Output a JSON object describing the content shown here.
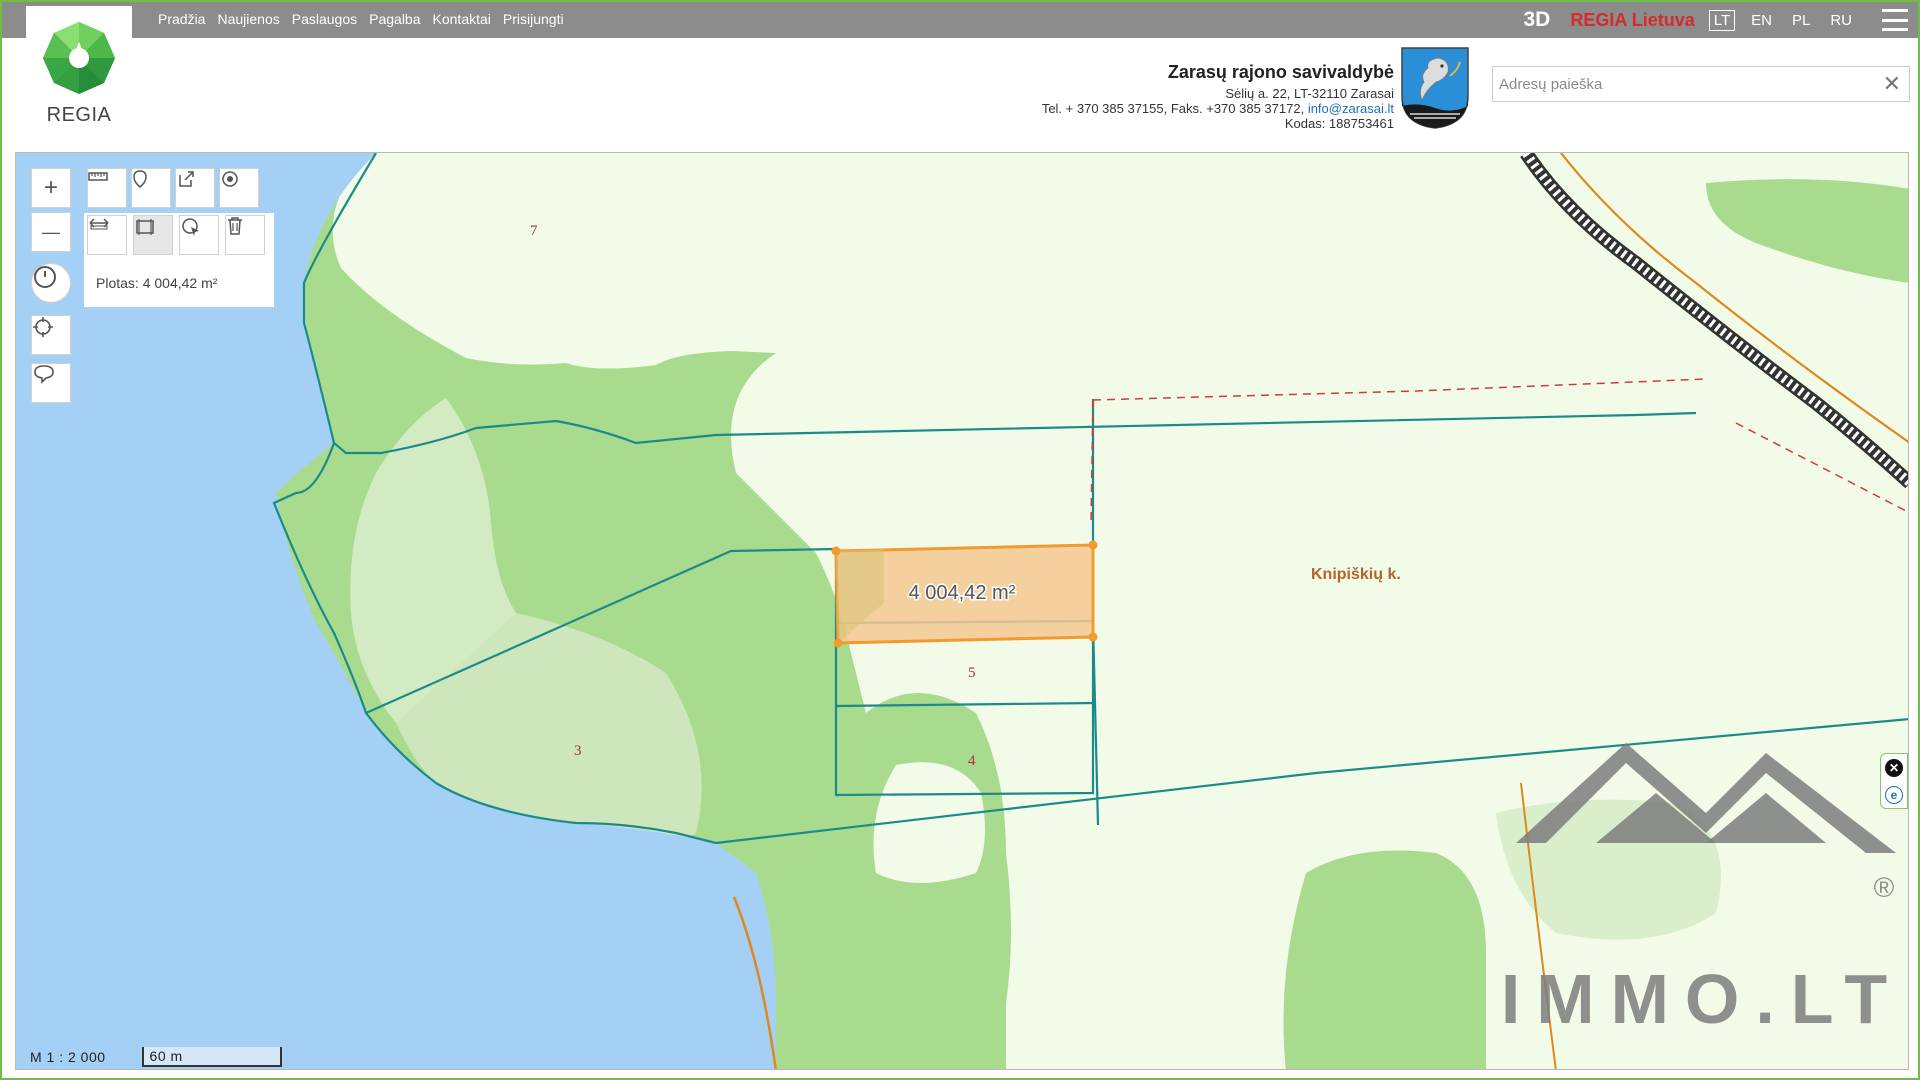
{
  "nav": {
    "items": [
      "Pradžia",
      "Naujienos",
      "Paslaugos",
      "Pagalba",
      "Kontaktai",
      "Prisijungti"
    ]
  },
  "logo": {
    "text": "REGIA"
  },
  "topright": {
    "mode_3d": "3D",
    "regia_lietuva": "REGIA Lietuva",
    "languages": [
      "LT",
      "EN",
      "PL",
      "RU"
    ],
    "active_language": "LT"
  },
  "municipality": {
    "name": "Zarasų rajono savivaldybė",
    "address": "Sėlių a. 22, LT-32110 Zarasai",
    "phone_line": "Tel. + 370 385 37155, Faks. +370 385 37172,",
    "email": "info@zarasai.lt",
    "code": "Kodas: 188753461"
  },
  "search": {
    "placeholder": "Adresų paieška",
    "value": ""
  },
  "tools": {
    "zoom_in": "+",
    "zoom_out": "—",
    "area_readout": "Plotas: 4 004,42 m²"
  },
  "map": {
    "parcel_labels": [
      "7",
      "3",
      "5",
      "4"
    ],
    "village_label": "Knipiškių k.",
    "measurement_label": "4 004,42 m²",
    "scale_ratio": "M 1 : 2 000",
    "scale_distance": "60 m",
    "watermark_text": "IMMO.LT",
    "watermark_mark": "®",
    "colors": {
      "water": "#a4d0f5",
      "forest": "#a9db8f",
      "meadow": "#f2fae8",
      "parcel_border": "#1d8a8a",
      "highlight_fill": "#f5c891",
      "highlight_border": "#f29a2e",
      "road": "#dc8a1e"
    }
  }
}
